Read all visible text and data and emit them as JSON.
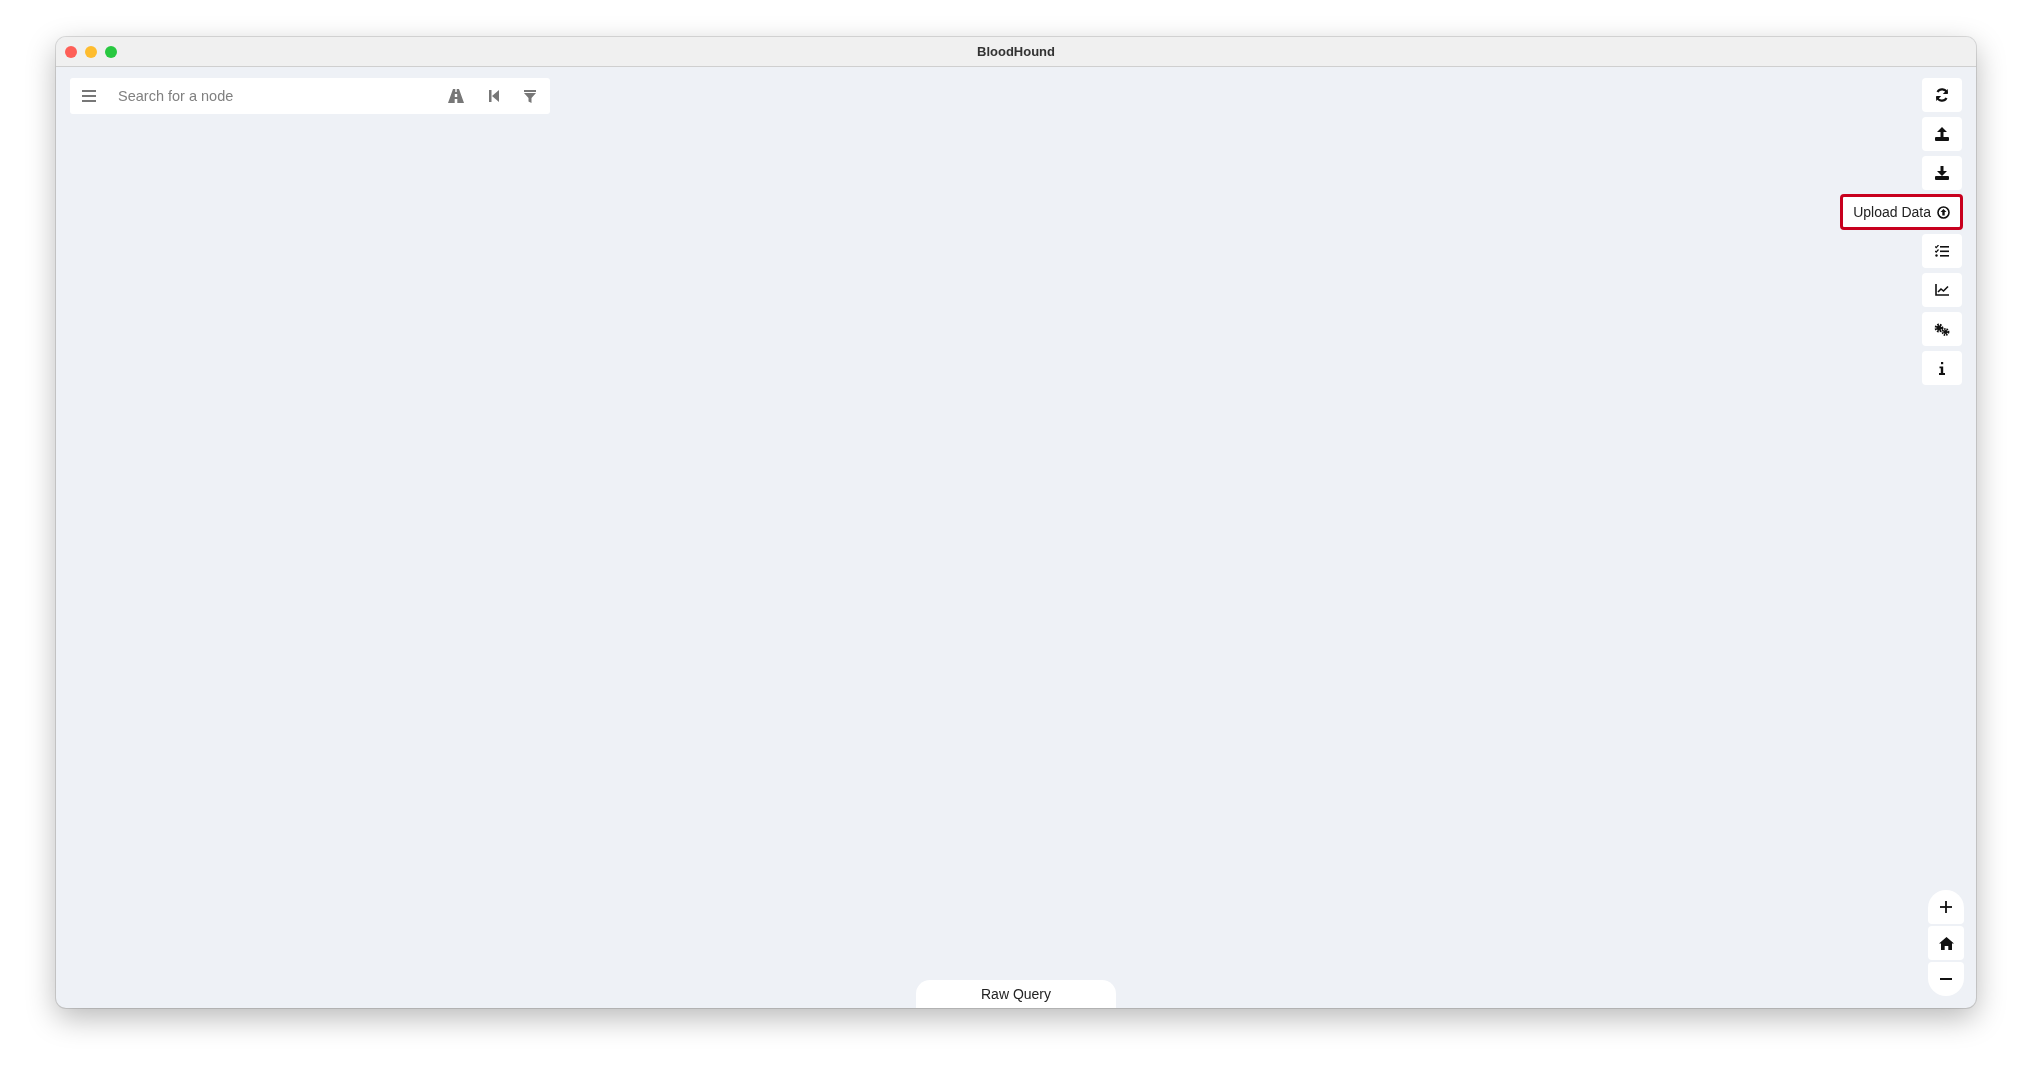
{
  "window": {
    "title": "BloodHound"
  },
  "search": {
    "placeholder": "Search for a node"
  },
  "toolbar": [
    {
      "kind": "icon"
    },
    {
      "kind": "icon"
    },
    {
      "kind": "icon"
    },
    {
      "kind": "labeled",
      "label": "Upload Data",
      "highlighted": true
    },
    {
      "kind": "icon"
    },
    {
      "kind": "icon"
    },
    {
      "kind": "icon"
    },
    {
      "kind": "icon"
    }
  ],
  "raw_query": {
    "label": "Raw Query"
  }
}
